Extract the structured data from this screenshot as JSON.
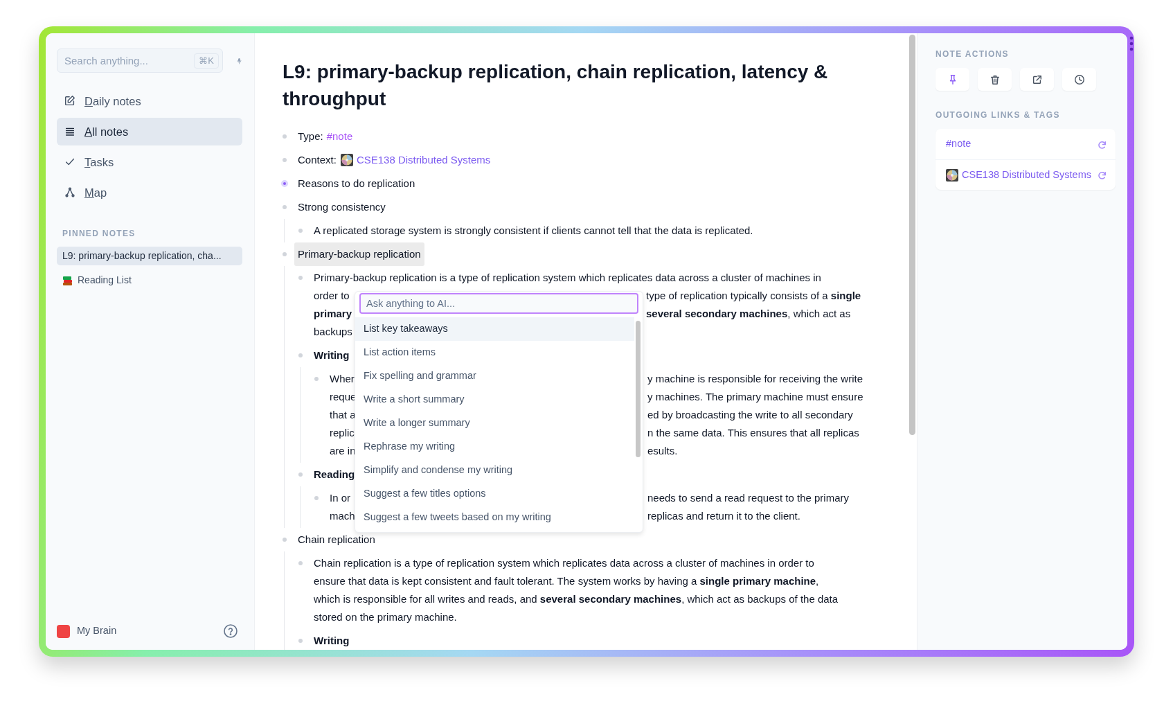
{
  "sidebar": {
    "search": {
      "placeholder": "Search anything...",
      "shortcut": "⌘K"
    },
    "nav": [
      {
        "label": "Daily notes",
        "selected": false
      },
      {
        "label": "All notes",
        "selected": true
      },
      {
        "label": "Tasks",
        "selected": false
      },
      {
        "label": "Map",
        "selected": false
      }
    ],
    "pinned_heading": "PINNED NOTES",
    "pinned": [
      {
        "label": "L9: primary-backup replication, cha...",
        "icon": false,
        "selected": true
      },
      {
        "label": "Reading List",
        "icon": true,
        "selected": false
      }
    ],
    "workspace": "My Brain"
  },
  "note": {
    "title": "L9: primary-backup replication, chain replication, latency & throughput",
    "items": [
      {
        "parts": [
          {
            "kind": "text",
            "text": "Type:"
          },
          {
            "kind": "tag",
            "text": "#note"
          }
        ],
        "focused": false,
        "highlighted": false
      },
      {
        "parts": [
          {
            "kind": "text",
            "text": "Context:"
          },
          {
            "kind": "link",
            "text": "CSE138 Distributed Systems"
          }
        ],
        "focused": false,
        "highlighted": false
      },
      {
        "lines": [
          {
            "left": "Reasons to do replication"
          }
        ],
        "focused": true,
        "highlighted": false
      },
      {
        "lines": [
          {
            "left": "Strong consistency"
          }
        ],
        "focused": false,
        "highlighted": false,
        "children": [
          {
            "kind": "text",
            "lines": [
              {
                "left": "A replicated storage system is strongly consistent if clients cannot tell that the data is replicated."
              }
            ]
          }
        ]
      },
      {
        "lines": [
          {
            "left": "Primary-backup replication"
          }
        ],
        "focused": false,
        "highlighted": true,
        "children": [
          {
            "kind": "text",
            "lines": [
              {
                "left": "Primary-backup replication is a type of replication system which replicates data across a cluster of machines in"
              },
              {
                "left": "order to",
                "right": "type of replication typically consists of a **single**"
              },
              {
                "left": "**primary**",
                "right": "**several secondary machines**, which act as"
              },
              {
                "left": "backups"
              }
            ]
          },
          {
            "kind": "heading",
            "lines": [
              {
                "left": "Writing"
              }
            ],
            "children": [
              {
                "kind": "text",
                "lines": [
                  {
                    "left": "Wher",
                    "right": "y machine is responsible for receiving the write"
                  },
                  {
                    "left": "reque",
                    "right": "y machines. The primary machine must ensure"
                  },
                  {
                    "left": "that a",
                    "right": "ed by broadcasting the write to all secondary"
                  },
                  {
                    "left": "replic",
                    "right": "n the same data. This ensures that all replicas"
                  },
                  {
                    "left": "are in",
                    "right": "esults."
                  }
                ]
              }
            ]
          },
          {
            "kind": "heading",
            "lines": [
              {
                "left": "Reading"
              }
            ],
            "children": [
              {
                "kind": "text",
                "lines": [
                  {
                    "left": "In or",
                    "right": "needs to send a read request to the primary"
                  },
                  {
                    "left": "mach",
                    "right": "replicas and return it to the client."
                  }
                ]
              }
            ]
          }
        ]
      },
      {
        "lines": [
          {
            "left": "Chain replication"
          }
        ],
        "focused": false,
        "highlighted": false,
        "children": [
          {
            "kind": "text",
            "lines": [
              {
                "left": "Chain replication is a type of replication system which replicates data across a cluster of machines in order to"
              },
              {
                "left": "ensure that data is kept consistent and fault tolerant. The system works by having a **single primary machine**,"
              },
              {
                "left": "which is responsible for all writes and reads, and **several secondary machines**, which act as backups of the data"
              },
              {
                "left": "stored on the primary machine."
              }
            ]
          },
          {
            "kind": "heading",
            "lines": [
              {
                "left": "Writing"
              }
            ]
          }
        ]
      }
    ]
  },
  "ai_menu": {
    "placeholder": "Ask anything to AI...",
    "options": [
      {
        "label": "List key takeaways",
        "selected": true
      },
      {
        "label": "List action items",
        "selected": false
      },
      {
        "label": "Fix spelling and grammar",
        "selected": false
      },
      {
        "label": "Write a short summary",
        "selected": false
      },
      {
        "label": "Write a longer summary",
        "selected": false
      },
      {
        "label": "Rephrase my writing",
        "selected": false
      },
      {
        "label": "Simplify and condense my writing",
        "selected": false
      },
      {
        "label": "Suggest a few titles options",
        "selected": false
      },
      {
        "label": "Suggest a few tweets based on my writing",
        "selected": false
      }
    ]
  },
  "panel": {
    "actions_heading": "NOTE ACTIONS",
    "pinned": true,
    "outgoing_heading": "OUTGOING LINKS & TAGS",
    "links": [
      {
        "kind": "tag",
        "label": "#note"
      },
      {
        "kind": "note",
        "label": "CSE138 Distributed Systems"
      }
    ]
  }
}
